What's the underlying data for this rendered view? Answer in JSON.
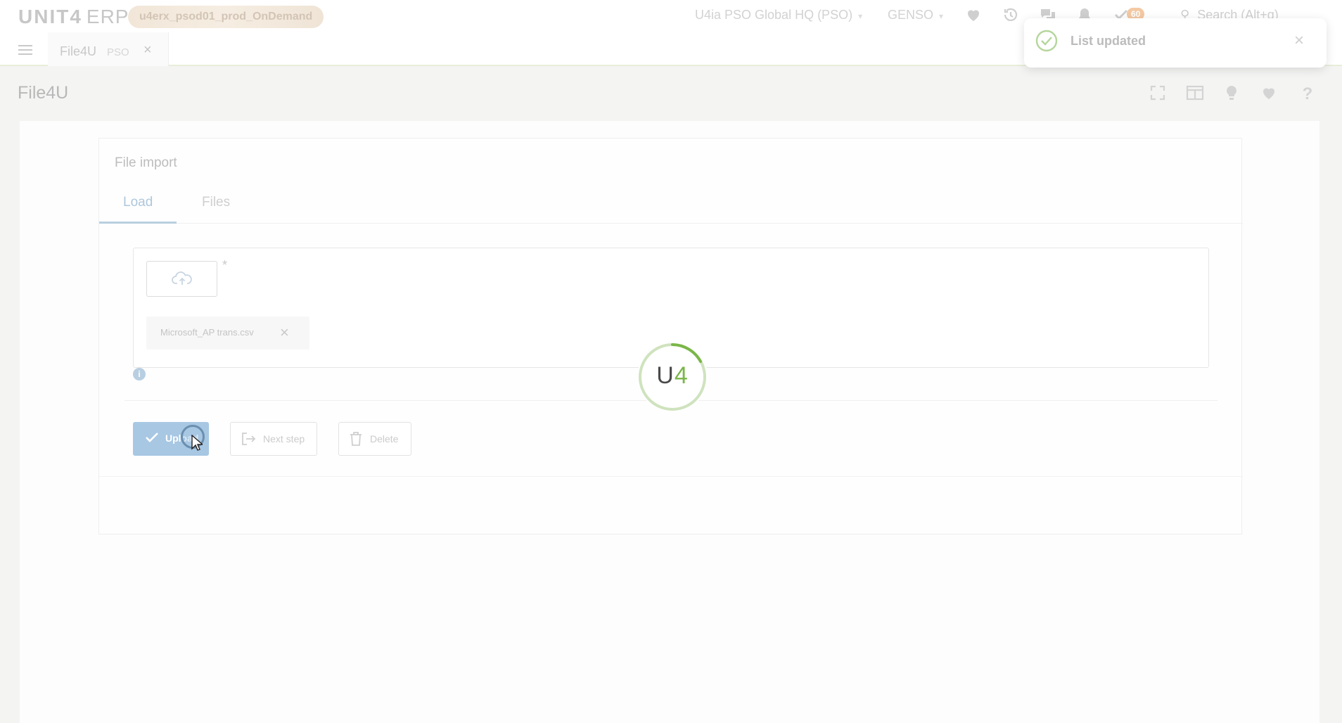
{
  "app": {
    "brand": "UNIT4",
    "product": "ERP",
    "environment": "u4erx_psod01_prod_OnDemand",
    "company": "U4ia PSO Global HQ (PSO)",
    "user": "GENSO",
    "pending_count": "60",
    "search_placeholder": "Search (Alt+q)"
  },
  "tabs": [
    {
      "label": "File4U",
      "sub": "PSO"
    }
  ],
  "page": {
    "title": "File4U"
  },
  "panel": {
    "title": "File import",
    "tabs": [
      "Load",
      "Files"
    ],
    "active_tab": "Load",
    "required_mark": "*",
    "file_name": "Microsoft_AP trans.csv",
    "info_icon": "i"
  },
  "buttons": {
    "upload": "Upload",
    "next_step": "Next step",
    "delete": "Delete"
  },
  "spinner": {
    "text_u": "U",
    "text_4": "4"
  },
  "toast": {
    "message": "List updated"
  },
  "colors": {
    "accent_blue": "#a7c7e3",
    "brand_green": "#7ab648",
    "success_green": "#b5d69b"
  }
}
